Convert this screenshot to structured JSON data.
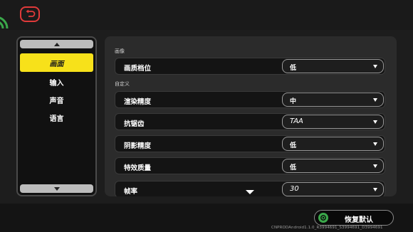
{
  "nav": {
    "items": [
      {
        "label": "画面",
        "active": true
      },
      {
        "label": "输入",
        "active": false
      },
      {
        "label": "声音",
        "active": false
      },
      {
        "label": "语言",
        "active": false
      }
    ]
  },
  "sections": {
    "image": "画像",
    "custom": "自定义"
  },
  "settings": [
    {
      "label": "画质档位",
      "value": "低"
    },
    {
      "label": "渲染精度",
      "value": "中"
    },
    {
      "label": "抗锯齿",
      "value": "TAA"
    },
    {
      "label": "阴影精度",
      "value": "低"
    },
    {
      "label": "特效质量",
      "value": "低"
    },
    {
      "label": "帧率",
      "value": "30"
    }
  ],
  "footer": {
    "reset_label": "恢复默认",
    "build": "CNPRODAndroid1.1.0_R3994691_S3994691_D3994691"
  },
  "colors": {
    "accent": "#f7e11a",
    "back": "#e03a3a",
    "reset_icon": "#3aa84a"
  },
  "icons": {
    "back": "return-arrow-icon",
    "reset": "reset-icon",
    "scroll_up": "triangle-up-icon",
    "scroll_down": "triangle-down-icon",
    "dropdown": "triangle-down-icon",
    "wifi": "wifi-icon"
  }
}
